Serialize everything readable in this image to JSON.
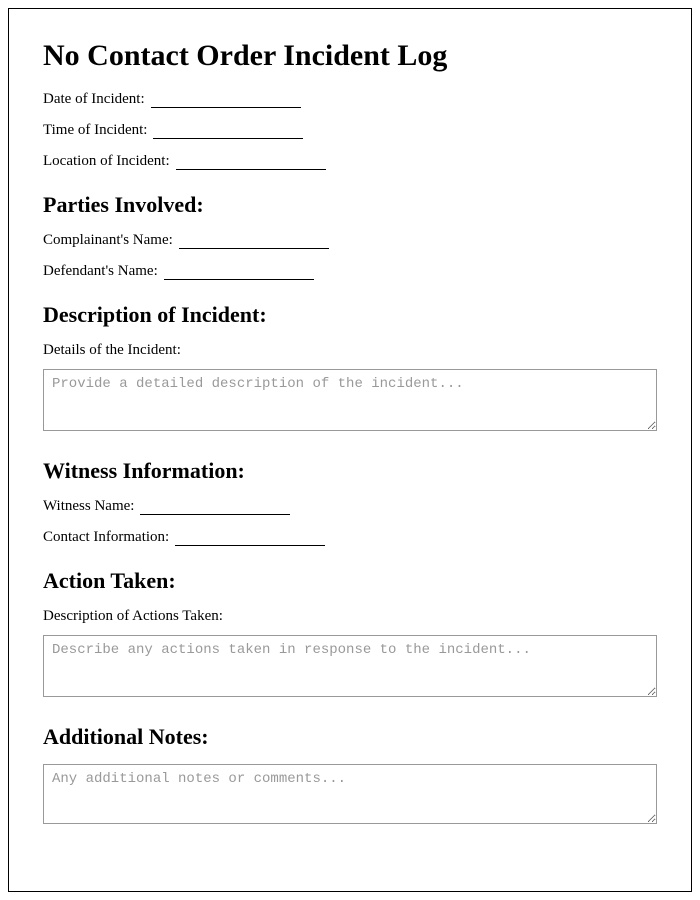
{
  "title": "No Contact Order Incident Log",
  "basic": {
    "date_label": "Date of Incident:",
    "time_label": "Time of Incident:",
    "location_label": "Location of Incident:"
  },
  "parties": {
    "heading": "Parties Involved:",
    "complainant_label": "Complainant's Name:",
    "defendant_label": "Defendant's Name:"
  },
  "description": {
    "heading": "Description of Incident:",
    "details_label": "Details of the Incident:",
    "details_placeholder": "Provide a detailed description of the incident..."
  },
  "witness": {
    "heading": "Witness Information:",
    "name_label": "Witness Name:",
    "contact_label": "Contact Information:"
  },
  "action": {
    "heading": "Action Taken:",
    "desc_label": "Description of Actions Taken:",
    "desc_placeholder": "Describe any actions taken in response to the incident..."
  },
  "notes": {
    "heading": "Additional Notes:",
    "placeholder": "Any additional notes or comments..."
  }
}
